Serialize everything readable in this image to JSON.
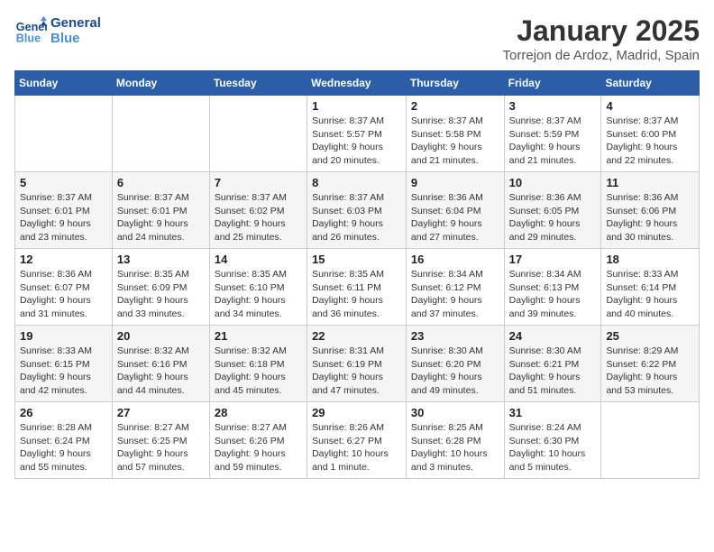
{
  "header": {
    "logo_line1": "General",
    "logo_line2": "Blue",
    "month": "January 2025",
    "location": "Torrejon de Ardoz, Madrid, Spain"
  },
  "weekdays": [
    "Sunday",
    "Monday",
    "Tuesday",
    "Wednesday",
    "Thursday",
    "Friday",
    "Saturday"
  ],
  "weeks": [
    [
      {
        "day": "",
        "info": ""
      },
      {
        "day": "",
        "info": ""
      },
      {
        "day": "",
        "info": ""
      },
      {
        "day": "1",
        "info": "Sunrise: 8:37 AM\nSunset: 5:57 PM\nDaylight: 9 hours\nand 20 minutes."
      },
      {
        "day": "2",
        "info": "Sunrise: 8:37 AM\nSunset: 5:58 PM\nDaylight: 9 hours\nand 21 minutes."
      },
      {
        "day": "3",
        "info": "Sunrise: 8:37 AM\nSunset: 5:59 PM\nDaylight: 9 hours\nand 21 minutes."
      },
      {
        "day": "4",
        "info": "Sunrise: 8:37 AM\nSunset: 6:00 PM\nDaylight: 9 hours\nand 22 minutes."
      }
    ],
    [
      {
        "day": "5",
        "info": "Sunrise: 8:37 AM\nSunset: 6:01 PM\nDaylight: 9 hours\nand 23 minutes."
      },
      {
        "day": "6",
        "info": "Sunrise: 8:37 AM\nSunset: 6:01 PM\nDaylight: 9 hours\nand 24 minutes."
      },
      {
        "day": "7",
        "info": "Sunrise: 8:37 AM\nSunset: 6:02 PM\nDaylight: 9 hours\nand 25 minutes."
      },
      {
        "day": "8",
        "info": "Sunrise: 8:37 AM\nSunset: 6:03 PM\nDaylight: 9 hours\nand 26 minutes."
      },
      {
        "day": "9",
        "info": "Sunrise: 8:36 AM\nSunset: 6:04 PM\nDaylight: 9 hours\nand 27 minutes."
      },
      {
        "day": "10",
        "info": "Sunrise: 8:36 AM\nSunset: 6:05 PM\nDaylight: 9 hours\nand 29 minutes."
      },
      {
        "day": "11",
        "info": "Sunrise: 8:36 AM\nSunset: 6:06 PM\nDaylight: 9 hours\nand 30 minutes."
      }
    ],
    [
      {
        "day": "12",
        "info": "Sunrise: 8:36 AM\nSunset: 6:07 PM\nDaylight: 9 hours\nand 31 minutes."
      },
      {
        "day": "13",
        "info": "Sunrise: 8:35 AM\nSunset: 6:09 PM\nDaylight: 9 hours\nand 33 minutes."
      },
      {
        "day": "14",
        "info": "Sunrise: 8:35 AM\nSunset: 6:10 PM\nDaylight: 9 hours\nand 34 minutes."
      },
      {
        "day": "15",
        "info": "Sunrise: 8:35 AM\nSunset: 6:11 PM\nDaylight: 9 hours\nand 36 minutes."
      },
      {
        "day": "16",
        "info": "Sunrise: 8:34 AM\nSunset: 6:12 PM\nDaylight: 9 hours\nand 37 minutes."
      },
      {
        "day": "17",
        "info": "Sunrise: 8:34 AM\nSunset: 6:13 PM\nDaylight: 9 hours\nand 39 minutes."
      },
      {
        "day": "18",
        "info": "Sunrise: 8:33 AM\nSunset: 6:14 PM\nDaylight: 9 hours\nand 40 minutes."
      }
    ],
    [
      {
        "day": "19",
        "info": "Sunrise: 8:33 AM\nSunset: 6:15 PM\nDaylight: 9 hours\nand 42 minutes."
      },
      {
        "day": "20",
        "info": "Sunrise: 8:32 AM\nSunset: 6:16 PM\nDaylight: 9 hours\nand 44 minutes."
      },
      {
        "day": "21",
        "info": "Sunrise: 8:32 AM\nSunset: 6:18 PM\nDaylight: 9 hours\nand 45 minutes."
      },
      {
        "day": "22",
        "info": "Sunrise: 8:31 AM\nSunset: 6:19 PM\nDaylight: 9 hours\nand 47 minutes."
      },
      {
        "day": "23",
        "info": "Sunrise: 8:30 AM\nSunset: 6:20 PM\nDaylight: 9 hours\nand 49 minutes."
      },
      {
        "day": "24",
        "info": "Sunrise: 8:30 AM\nSunset: 6:21 PM\nDaylight: 9 hours\nand 51 minutes."
      },
      {
        "day": "25",
        "info": "Sunrise: 8:29 AM\nSunset: 6:22 PM\nDaylight: 9 hours\nand 53 minutes."
      }
    ],
    [
      {
        "day": "26",
        "info": "Sunrise: 8:28 AM\nSunset: 6:24 PM\nDaylight: 9 hours\nand 55 minutes."
      },
      {
        "day": "27",
        "info": "Sunrise: 8:27 AM\nSunset: 6:25 PM\nDaylight: 9 hours\nand 57 minutes."
      },
      {
        "day": "28",
        "info": "Sunrise: 8:27 AM\nSunset: 6:26 PM\nDaylight: 9 hours\nand 59 minutes."
      },
      {
        "day": "29",
        "info": "Sunrise: 8:26 AM\nSunset: 6:27 PM\nDaylight: 10 hours\nand 1 minute."
      },
      {
        "day": "30",
        "info": "Sunrise: 8:25 AM\nSunset: 6:28 PM\nDaylight: 10 hours\nand 3 minutes."
      },
      {
        "day": "31",
        "info": "Sunrise: 8:24 AM\nSunset: 6:30 PM\nDaylight: 10 hours\nand 5 minutes."
      },
      {
        "day": "",
        "info": ""
      }
    ]
  ]
}
